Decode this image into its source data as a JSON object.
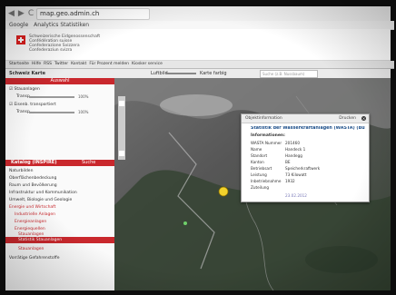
{
  "browser": {
    "nav": [
      "◀",
      "▶",
      "C"
    ],
    "url": "map.geo.admin.ch",
    "bookmarks": [
      "Google",
      "Analytics Statistiken"
    ]
  },
  "header": {
    "confed_lines": [
      "Schweizerische Eidgenossenschaft",
      "Confédération suisse",
      "Confederazione Svizzera",
      "Confederaziun svizra"
    ],
    "tabs": [
      "Startseite",
      "Hilfe",
      "RSS",
      "Twitter",
      "Kontakt",
      "Für Prozent melden",
      "Kiosker service"
    ]
  },
  "mapbar": {
    "title": "Schweiz Karte",
    "luftbild": "Luftbild",
    "karte_farbig": "Karte farbig",
    "search_placeholder": "Suche (z.B. Nussbaum)"
  },
  "left": {
    "auswahl": "Auswahl",
    "layers": [
      {
        "label": "Stauanlagen",
        "checked": true
      },
      {
        "label": "Transp",
        "opacity": "100%"
      },
      {
        "label": "Eisenb. transportiert",
        "checked": true
      },
      {
        "label": "Transp",
        "opacity": "100%"
      }
    ],
    "katalog_tab": "Katalog (INSPIRE)",
    "suche_tab": "Suche",
    "categories": [
      {
        "label": "Naturbilden",
        "level": 0
      },
      {
        "label": "Oberflächenbedeckung",
        "level": 0
      },
      {
        "label": "Raum und Bevölkerung",
        "level": 0
      },
      {
        "label": "Infrastruktur und Kommunikation",
        "level": 0
      },
      {
        "label": "Umwelt, Biologie und Geologie",
        "level": 0
      },
      {
        "label": "Energie und Wirtschaft",
        "level": 0
      },
      {
        "label": "Industrielle Anlagen",
        "level": 1
      },
      {
        "label": "Energieanlagen",
        "level": 1
      },
      {
        "label": "Energiequellen",
        "level": 1
      },
      {
        "label": "Stauanlagen",
        "level": 2
      }
    ],
    "selected": "Statistik Stauanlagen",
    "after": [
      {
        "label": "Stauanlagen"
      },
      {
        "label": "Vorrätige Gefahrenstoffe"
      }
    ]
  },
  "popup": {
    "header": "Objektinformation",
    "drucken": "Drucken",
    "title": "Statistik der Wasserkraftanlagen (WASTA) (Bundesamt für Energie)",
    "info_label": "Informationen:",
    "rows": [
      {
        "k": "WASTA Nummer",
        "v": "201460"
      },
      {
        "k": "Name",
        "v": "Handeck 1"
      },
      {
        "k": "Standort",
        "v": "Handegg"
      },
      {
        "k": "Kanton",
        "v": "BE"
      },
      {
        "k": "Betriebsart",
        "v": "Speicherkraftwerk"
      },
      {
        "k": "Leistung",
        "v": "73 Kilowatt"
      },
      {
        "k": "Inbetriebnahme",
        "v": "1932"
      },
      {
        "k": "Zuteilung",
        "v": ""
      }
    ],
    "date": "23.02.2012"
  },
  "colors": {
    "accent": "#c9282d",
    "link": "#1d4f8a"
  }
}
